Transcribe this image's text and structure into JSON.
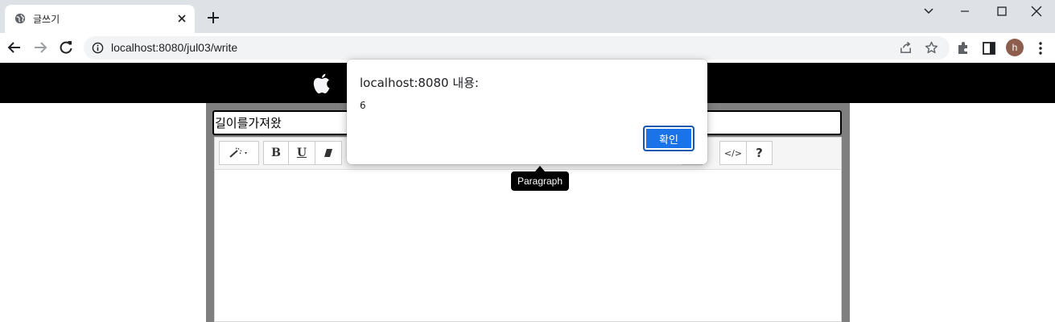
{
  "browser": {
    "tab": {
      "title": "글쓰기",
      "favicon": "globe-icon"
    },
    "url": "localhost:8080/jul03/write",
    "profile_initial": "h"
  },
  "page": {
    "header_logo": "apple-logo-icon",
    "title_value": "길이를가져왔",
    "toolbar_buttons": [
      {
        "name": "magic-wand-style-dropdown",
        "icon": "magic-wand-icon"
      },
      {
        "name": "bold",
        "label": "B"
      },
      {
        "name": "underline",
        "label": "U"
      },
      {
        "name": "eraser",
        "icon": "eraser-icon"
      },
      {
        "name": "code-view",
        "label": "</>"
      },
      {
        "name": "help",
        "label": "?"
      }
    ],
    "tooltip": "Paragraph"
  },
  "dialog": {
    "title": "localhost:8080 내용:",
    "message": "6",
    "ok_label": "확인"
  },
  "colors": {
    "tab_strip": "#dee1e6",
    "header_bg": "#000000",
    "frame_bg": "#7f7f7f",
    "ok_button": "#1a73e8"
  }
}
